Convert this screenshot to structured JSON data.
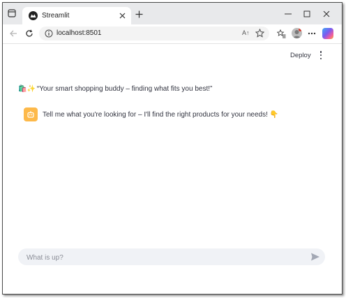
{
  "browser": {
    "tab": {
      "title": "Streamlit"
    },
    "address": {
      "url": "localhost:8501"
    },
    "icons": {
      "tab_actions": "tab-actions-icon",
      "favicon": "streamlit-icon",
      "tab_close": "close-icon",
      "new_tab": "plus-icon",
      "minimize": "minimize-icon",
      "maximize": "maximize-icon",
      "close_window": "close-icon",
      "back": "back-arrow-icon",
      "refresh": "refresh-icon",
      "site_info": "info-icon",
      "read_aloud": "read-aloud-icon",
      "favorite": "star-icon",
      "favorites": "favorites-icon",
      "profile": "avatar",
      "more": "more-icon",
      "copilot": "copilot-icon"
    },
    "read_aloud_label": "A↑"
  },
  "app": {
    "header": {
      "deploy_label": "Deploy"
    },
    "tagline": {
      "emoji": "🛍️✨",
      "text": "“Your smart shopping buddy – finding what fits you best!”"
    },
    "assistant_message": {
      "text": "Tell me what you're looking for – I'll find the right products for your needs!",
      "emoji": "👇"
    },
    "chat_input": {
      "placeholder": "What is up?",
      "value": ""
    }
  },
  "colors": {
    "tab_strip": "#e8e9eb",
    "assistant_avatar": "#fdb94a",
    "chat_input_bg": "#f0f2f6",
    "text": "#31333f"
  }
}
